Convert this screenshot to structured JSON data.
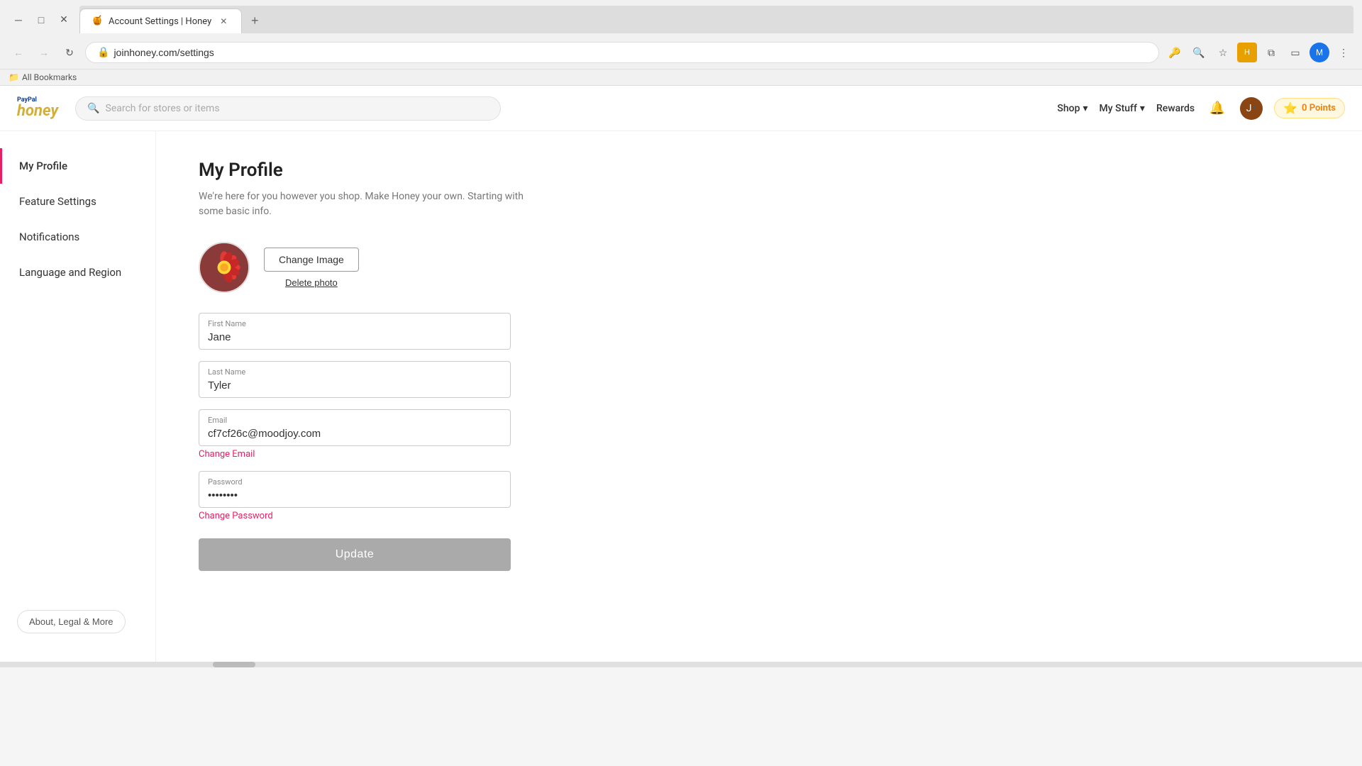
{
  "browser": {
    "tab_title": "Account Settings | Honey",
    "tab_favicon": "🍯",
    "url": "joinhoney.com/settings",
    "bookmarks_label": "All Bookmarks"
  },
  "nav": {
    "logo_paypal": "PayPal",
    "logo_honey": "honey",
    "search_placeholder": "Search for stores or items",
    "shop_label": "Shop",
    "mystuff_label": "My Stuff",
    "rewards_label": "Rewards",
    "points_label": "0 Points"
  },
  "sidebar": {
    "items": [
      {
        "id": "my-profile",
        "label": "My Profile",
        "active": true
      },
      {
        "id": "feature-settings",
        "label": "Feature Settings",
        "active": false
      },
      {
        "id": "notifications",
        "label": "Notifications",
        "active": false
      },
      {
        "id": "language-region",
        "label": "Language and Region",
        "active": false
      }
    ],
    "about_label": "About, Legal & More"
  },
  "profile": {
    "page_title": "My Profile",
    "page_subtitle": "We're here for you however you shop. Make Honey your own. Starting with\nsome basic info.",
    "change_image_label": "Change Image",
    "delete_photo_label": "Delete photo",
    "first_name_label": "First Name",
    "first_name_value": "Jane",
    "last_name_label": "Last Name",
    "last_name_value": "Tyler",
    "email_label": "Email",
    "email_value": "cf7cf26c@moodjoy.com",
    "change_email_label": "Change Email",
    "password_label": "Password",
    "password_value": "••••••••",
    "change_password_label": "Change Password",
    "update_label": "Update"
  }
}
